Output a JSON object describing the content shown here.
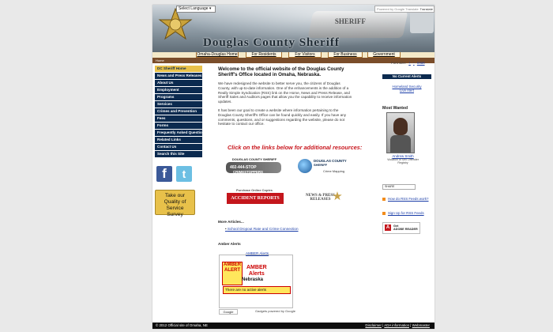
{
  "header": {
    "select_language": "Select Language",
    "translate_placeholder": "Powered by Google Translate",
    "translate_button": "Translate",
    "title": "Douglas County Sheriff",
    "car_text": "SHERIFF"
  },
  "nav": [
    "Omaha-Douglas Home",
    "For Residents",
    "For Visitors",
    "For Business",
    "Government"
  ],
  "breadcrumb": "Home",
  "sidebar": {
    "items": [
      "DC Sheriff Home",
      "News and Press Releases",
      "About Us",
      "Employment",
      "Programs",
      "Services",
      "Crimes and Prevention",
      "Fees",
      "Forms",
      "Frequently Asked Questions",
      "Related Links",
      "Contact Us",
      "Search this Site"
    ],
    "facebook_icon": "f",
    "twitter_icon": "t",
    "survey": [
      "Take our",
      "Quality of Service",
      "Survey"
    ]
  },
  "main": {
    "welcome": "Welcome to the official website of the Douglas County Sheriff's Office located in Omaha, Nebraska.",
    "para1": "We have redesigned the website to better serve you, the citizens of Douglas County, with up-to-date information. One of the enhancements is the addition of a Really Simple Syndication (RSS) link on the Home, News and Press Release, and Sheriff Sales and Auditors pages that allow you the capability to receive information updates.",
    "para2": "It has been our goal to create a website where information pertaining to the Douglas County Sheriff's Office can be found quickly and easily. If you have any comments, questions, and or suggestions regarding the website, please do not hesitate to contact our office.",
    "resources": "Click on the links below for additional resources:",
    "crimestoppers_label": "DOUGLAS COUNTY SHERIFF",
    "crimestoppers_phone": "402-444-STOP",
    "crimestoppers_name": "CRIMESTOPPERS",
    "crimemap_t1": "DOUGLAS COUNTY",
    "crimemap_t2": "SHERIFF",
    "crimemap_t3": "Crime Mapping",
    "accident_cap": "Purchase Online Copies",
    "accident_bar": "ACCIDENT REPORTS",
    "news_text1": "NEWS & PRESS",
    "news_text2": "RELEASES",
    "more_articles": "More Articles...",
    "article_link": "School Dropout Rate and Crime Connection",
    "amber_heading": "Amber Alerts",
    "amber_link": "AMBER Alerts",
    "amber_logo": "AMBER ALERT",
    "amber_title1": "AMBER",
    "amber_title2": "Alerts",
    "amber_state": "Nebraska",
    "amber_message": "There are no active alerts",
    "google_badge": "Google",
    "powered": "Gadgets powered by Google"
  },
  "right": {
    "font_size": "Font size:",
    "font_plus": "+",
    "font_minus": "-",
    "reset": "reset",
    "current_alerts": "No Current Alerts",
    "homeland_1": "Homeland Security",
    "homeland_2": "Live Alert",
    "most_wanted": "Most Wanted",
    "wanted_name": "Andrew Smith",
    "wanted_sub": "Violation of Sex Offender Registry",
    "share": "SHARE",
    "rss_how": "How do RSS Feeds work?",
    "rss_signup": "Sign Up for RSS Feeds",
    "adobe_get": "Get",
    "adobe_name": "ADOBE READER"
  },
  "footer": {
    "copyright": "© 2012 Official site of Omaha, NE",
    "disclaimer": "Disclaimer",
    "ada": "ADA information",
    "webmaster": "Webmaster",
    "sep": "|"
  }
}
